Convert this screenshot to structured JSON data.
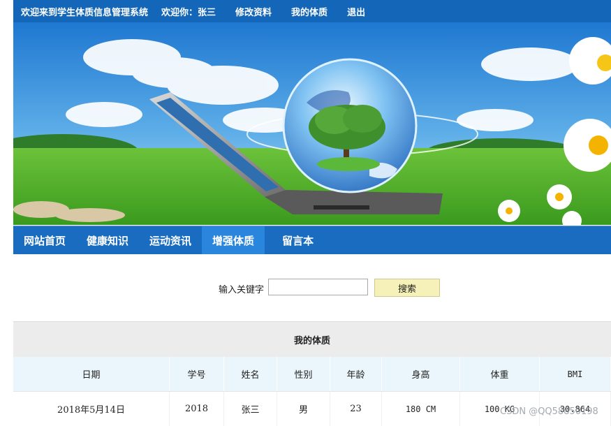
{
  "topbar": {
    "site_title": "欢迎来到学生体质信息管理系统",
    "welcome": "欢迎你：张三",
    "links": [
      "修改资料",
      "我的体质",
      "退出"
    ]
  },
  "nav": {
    "items": [
      "网站首页",
      "健康知识",
      "运动资讯",
      "增强体质",
      "留言本"
    ],
    "active_index": 3
  },
  "search": {
    "label": "输入关键字",
    "value": "",
    "button": "搜索"
  },
  "table": {
    "caption": "我的体质",
    "columns": [
      "日期",
      "学号",
      "姓名",
      "性别",
      "年龄",
      "身高",
      "体重",
      "BMI"
    ],
    "rows": [
      [
        "2018年5月14日",
        "2018",
        "张三",
        "男",
        "23",
        "180 CM",
        "100 KG",
        "30.864"
      ]
    ]
  },
  "watermark": "CSDN @QQ58850198",
  "colors": {
    "topbar": "#1466b8",
    "nav": "#1a6cc0",
    "nav_active": "#2a86dc",
    "search_button": "#f5f1b8",
    "table_header": "#eaf6fb",
    "caption_bg": "#ececec"
  }
}
